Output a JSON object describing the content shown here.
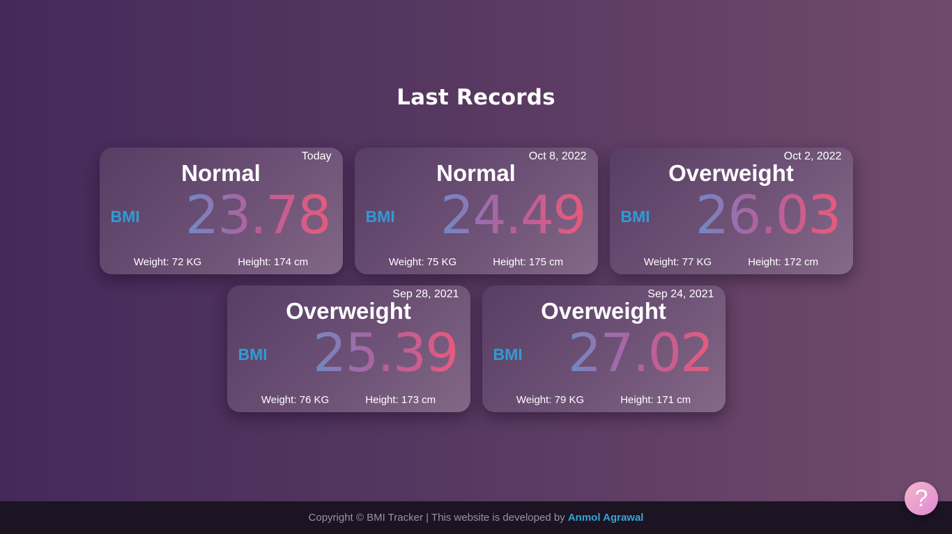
{
  "page": {
    "title": "Last Records"
  },
  "records": [
    {
      "date": "Today",
      "status": "Normal",
      "bmi_label": "BMI",
      "bmi": "23.78",
      "weight": "Weight: 72 KG",
      "height": "Height: 174 cm"
    },
    {
      "date": "Oct 8, 2022",
      "status": "Normal",
      "bmi_label": "BMI",
      "bmi": "24.49",
      "weight": "Weight: 75 KG",
      "height": "Height: 175 cm"
    },
    {
      "date": "Oct 2, 2022",
      "status": "Overweight",
      "bmi_label": "BMI",
      "bmi": "26.03",
      "weight": "Weight: 77 KG",
      "height": "Height: 172 cm"
    },
    {
      "date": "Sep 28, 2021",
      "status": "Overweight",
      "bmi_label": "BMI",
      "bmi": "25.39",
      "weight": "Weight: 76 KG",
      "height": "Height: 173 cm"
    },
    {
      "date": "Sep 24, 2021",
      "status": "Overweight",
      "bmi_label": "BMI",
      "bmi": "27.02",
      "weight": "Weight: 79 KG",
      "height": "Height: 171 cm"
    }
  ],
  "footer": {
    "copyright": "Copyright © BMI Tracker | This website is developed by ",
    "developer": "Anmol Agrawal"
  },
  "help_button": {
    "icon": "question-icon",
    "glyph": "?"
  },
  "colors": {
    "bmi_label": "#2f9bd6",
    "developer_link": "#35a4d6"
  }
}
